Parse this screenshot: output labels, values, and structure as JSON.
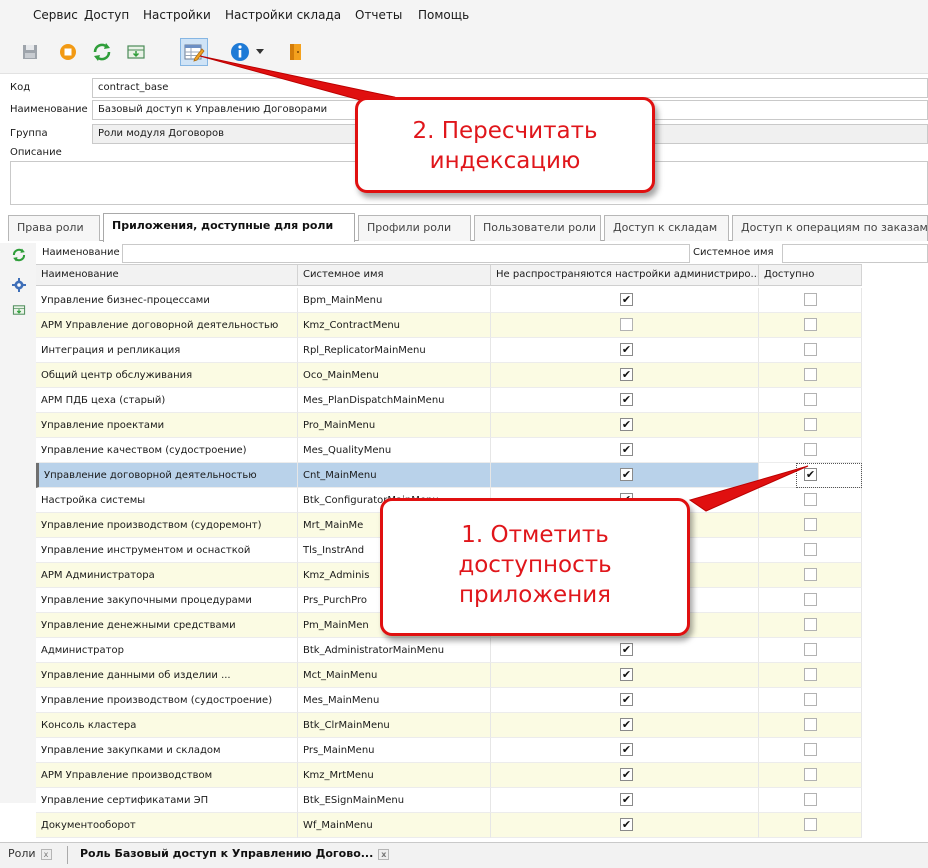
{
  "menu": [
    "Сервис",
    "Доступ",
    "Настройки",
    "Настройки склада",
    "Отчеты",
    "Помощь"
  ],
  "toolbar": {
    "buttons": [
      {
        "icon": "save-icon"
      },
      {
        "icon": "stop-icon"
      },
      {
        "icon": "refresh-icon"
      },
      {
        "icon": "import-icon"
      },
      {
        "icon": "edit-table-icon"
      },
      {
        "icon": "info-icon"
      },
      {
        "icon": "dropdown-arrow-icon"
      },
      {
        "icon": "exit-door-icon"
      }
    ]
  },
  "form": {
    "code_label": "Код",
    "code_value": "contract_base",
    "name_label": "Наименование",
    "name_value": "Базовый доступ к Управлению Договорами",
    "group_label": "Группа",
    "group_value": "Роли модуля Договоров",
    "description_label": "Описание",
    "description_value": ""
  },
  "tabs": [
    "Права роли",
    "Приложения, доступные для роли",
    "Профили роли",
    "Пользователи роли",
    "Доступ к складам",
    "Доступ к операциям по заказам"
  ],
  "active_tab": 1,
  "filter": {
    "name_label": "Наименование",
    "name_value": "",
    "sysname_label": "Системное имя",
    "sysname_value": ""
  },
  "table": {
    "columns": [
      "Наименование",
      "Системное имя",
      "Не распространяются настройки администриро...",
      "Доступно"
    ],
    "rows": [
      {
        "name": "Управление бизнес-процессами",
        "sys": "Bpm_MainMenu",
        "no_admin": true,
        "available": false
      },
      {
        "name": "АРМ Управление договорной деятельностью",
        "sys": "Kmz_ContractMenu",
        "no_admin": false,
        "available": false
      },
      {
        "name": "Интеграция и репликация",
        "sys": "Rpl_ReplicatorMainMenu",
        "no_admin": true,
        "available": false
      },
      {
        "name": "Общий центр обслуживания",
        "sys": "Oco_MainMenu",
        "no_admin": true,
        "available": false
      },
      {
        "name": "АРМ ПДБ цеха (старый)",
        "sys": "Mes_PlanDispatchMainMenu",
        "no_admin": true,
        "available": false
      },
      {
        "name": "Управление проектами",
        "sys": "Pro_MainMenu",
        "no_admin": true,
        "available": false
      },
      {
        "name": "Управление качеством (судостроение)",
        "sys": "Mes_QualityMenu",
        "no_admin": true,
        "available": false
      },
      {
        "name": "Управление договорной деятельностью",
        "sys": "Cnt_MainMenu",
        "no_admin": true,
        "available": true
      },
      {
        "name": "Настройка системы",
        "sys": "Btk_ConfiguratorMainMenu",
        "no_admin": true,
        "available": false
      },
      {
        "name": "Управление производством (судоремонт)",
        "sys": "Mrt_MainMe",
        "no_admin": true,
        "available": false
      },
      {
        "name": "Управление инструментом и оснасткой",
        "sys": "Tls_InstrAnd",
        "no_admin": true,
        "available": false
      },
      {
        "name": "АРМ Администратора",
        "sys": "Kmz_Adminis",
        "no_admin": true,
        "available": false
      },
      {
        "name": "Управление закупочными процедурами",
        "sys": "Prs_PurchPro",
        "no_admin": true,
        "available": false
      },
      {
        "name": "Управление денежными средствами",
        "sys": "Pm_MainMen",
        "no_admin": true,
        "available": false
      },
      {
        "name": "Администратор",
        "sys": "Btk_AdministratorMainMenu",
        "no_admin": true,
        "available": false
      },
      {
        "name": "Управление данными об изделии ...",
        "sys": "Mct_MainMenu",
        "no_admin": true,
        "available": false
      },
      {
        "name": "Управление производством (судостроение)",
        "sys": "Mes_MainMenu",
        "no_admin": true,
        "available": false
      },
      {
        "name": "Консоль кластера",
        "sys": "Btk_ClrMainMenu",
        "no_admin": true,
        "available": false
      },
      {
        "name": "Управление закупками и складом",
        "sys": "Prs_MainMenu",
        "no_admin": true,
        "available": false
      },
      {
        "name": "АРМ Управление производством",
        "sys": "Kmz_MrtMenu",
        "no_admin": true,
        "available": false
      },
      {
        "name": "Управление сертификатами ЭП",
        "sys": "Btk_ESignMainMenu",
        "no_admin": true,
        "available": false
      },
      {
        "name": "Документооборот",
        "sys": "Wf_MainMenu",
        "no_admin": true,
        "available": false
      }
    ],
    "selected_row": 7
  },
  "callouts": {
    "recalc": "2. Пересчитать индексацию",
    "mark": "1. Отметить доступность приложения"
  },
  "bottom_tabs": [
    "Роли",
    "Роль Базовый доступ к Управлению Догово..."
  ],
  "colors": {
    "accent_red": "#e01010",
    "selection": "#b9d2ea",
    "row_alt": "#fbfbe3"
  }
}
